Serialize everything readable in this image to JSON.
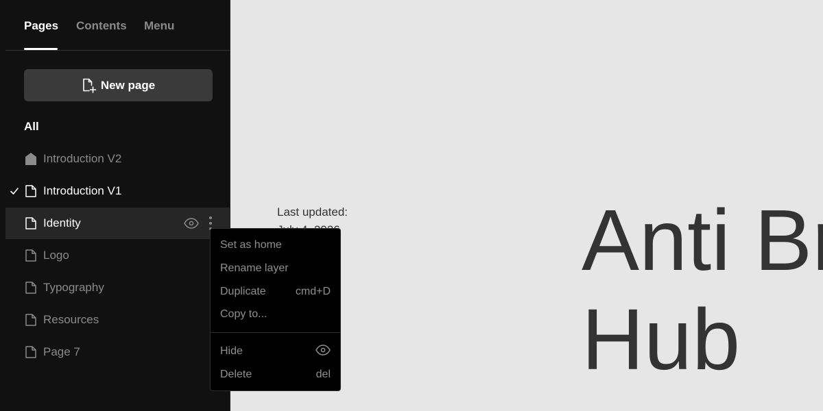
{
  "sidebar": {
    "tabs": [
      {
        "label": "Pages"
      },
      {
        "label": "Contents"
      },
      {
        "label": "Menu"
      }
    ],
    "new_page_label": "New page",
    "section_label": "All",
    "pages": [
      {
        "label": "Introduction V2",
        "icon": "home-icon"
      },
      {
        "label": "Introduction V1",
        "icon": "page-icon",
        "current": true
      },
      {
        "label": "Identity",
        "icon": "page-icon",
        "hovered": true
      },
      {
        "label": "Logo",
        "icon": "page-icon"
      },
      {
        "label": "Typography",
        "icon": "page-icon"
      },
      {
        "label": "Resources",
        "icon": "page-icon"
      },
      {
        "label": "Page 7",
        "icon": "page-icon"
      }
    ]
  },
  "context_menu": {
    "items": [
      {
        "label": "Set as home",
        "shortcut": ""
      },
      {
        "label": "Rename layer",
        "shortcut": ""
      },
      {
        "label": "Duplicate",
        "shortcut": "cmd+D"
      },
      {
        "label": "Copy to...",
        "shortcut": ""
      },
      {
        "label": "Hide",
        "shortcut": ""
      },
      {
        "label": "Delete",
        "shortcut": "del"
      }
    ]
  },
  "canvas": {
    "updated_label": "Last updated:",
    "updated_date": "July 4, 2026",
    "hero_line1": "Anti Br",
    "hero_line2": "Hub"
  },
  "colors": {
    "sidebar_bg": "#111111",
    "canvas_bg": "#e6e6e6",
    "button_bg": "#3a3a3a",
    "menu_bg": "#000000"
  }
}
